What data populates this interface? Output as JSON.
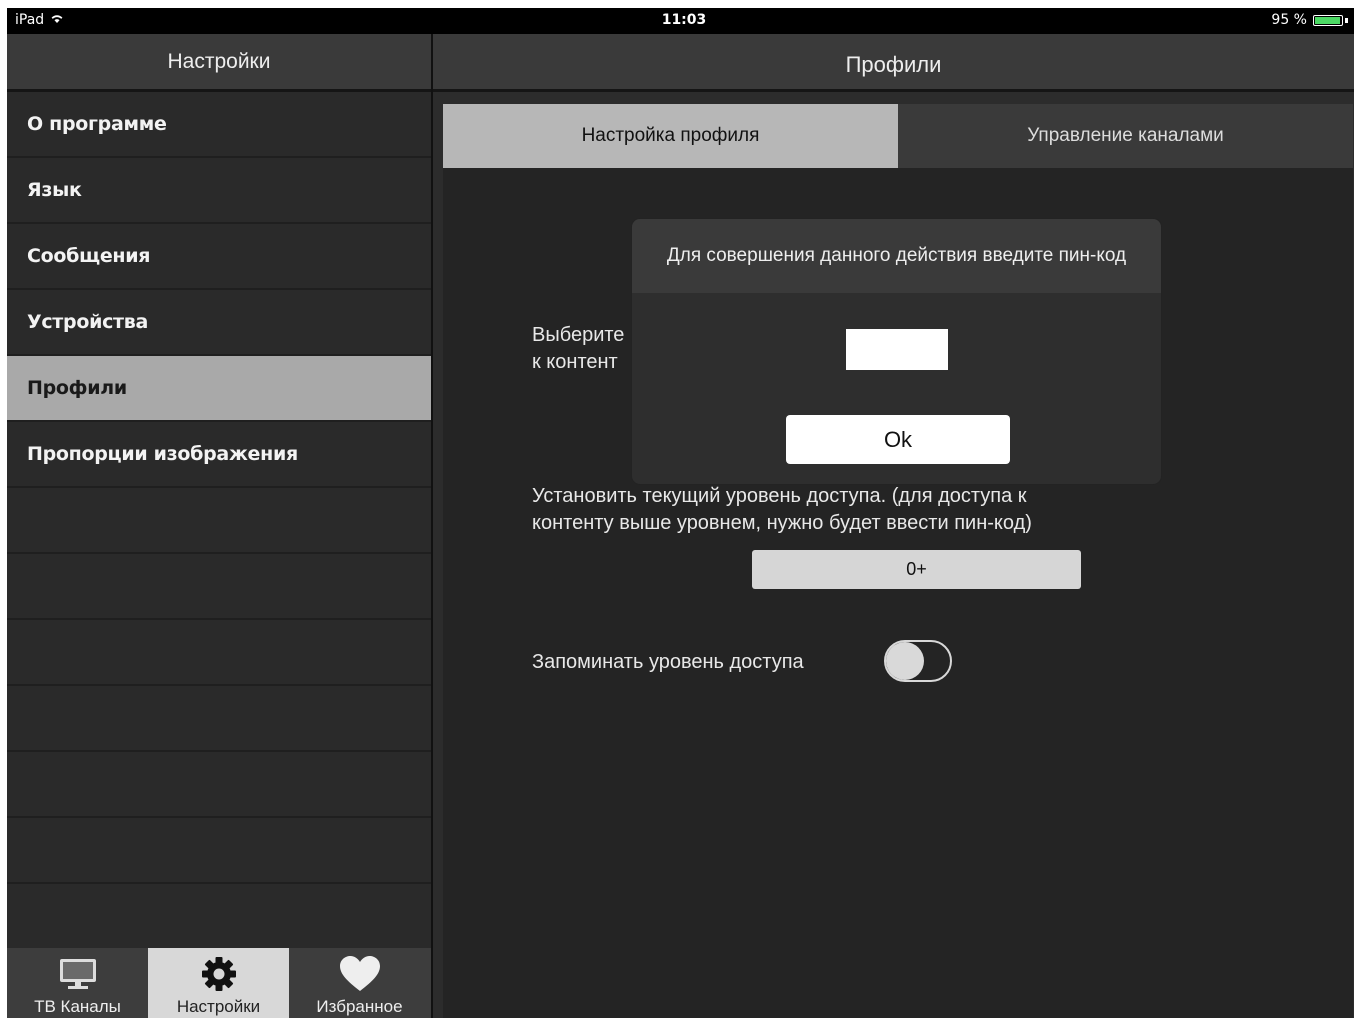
{
  "status_bar": {
    "device": "iPad",
    "time": "11:03",
    "battery": "95 %",
    "battery_level": 0.95,
    "battery_color": "#4cd964"
  },
  "sidebar": {
    "title": "Настройки",
    "items": [
      {
        "label": "О программе",
        "active": false
      },
      {
        "label": "Язык",
        "active": false
      },
      {
        "label": "Сообщения",
        "active": false
      },
      {
        "label": "Устройства",
        "active": false
      },
      {
        "label": "Профили",
        "active": true
      },
      {
        "label": "Пропорции изображения",
        "active": false
      }
    ]
  },
  "tabbar": {
    "tabs": [
      {
        "label": "ТВ Каналы",
        "icon": "tv-icon",
        "active": false
      },
      {
        "label": "Настройки",
        "icon": "gear-icon",
        "active": true
      },
      {
        "label": "Избранное",
        "icon": "heart-icon",
        "active": false
      }
    ]
  },
  "main": {
    "title": "Профили",
    "segments": [
      {
        "label": "Настройка профиля",
        "active": true
      },
      {
        "label": "Управление каналами",
        "active": false
      }
    ],
    "choose_text_line1": "Выберите",
    "choose_text_line2": "к контент",
    "access_text_line1": "Установить текущий уровень доступа. (для доступа к",
    "access_text_line2": "контенту выше уровнем, нужно будет ввести пин-код)",
    "level_value": "0+",
    "remember_label": "Запоминать уровень доступа",
    "remember_toggle_on": false
  },
  "modal": {
    "title": "Для совершения данного действия введите пин-код",
    "pin_value": "",
    "ok_label": "Ok"
  },
  "colors": {
    "active_menu_bg": "#a9a9a9",
    "active_tab_bg": "#d8d8d8",
    "active_segment_bg": "#b7b7b7"
  }
}
